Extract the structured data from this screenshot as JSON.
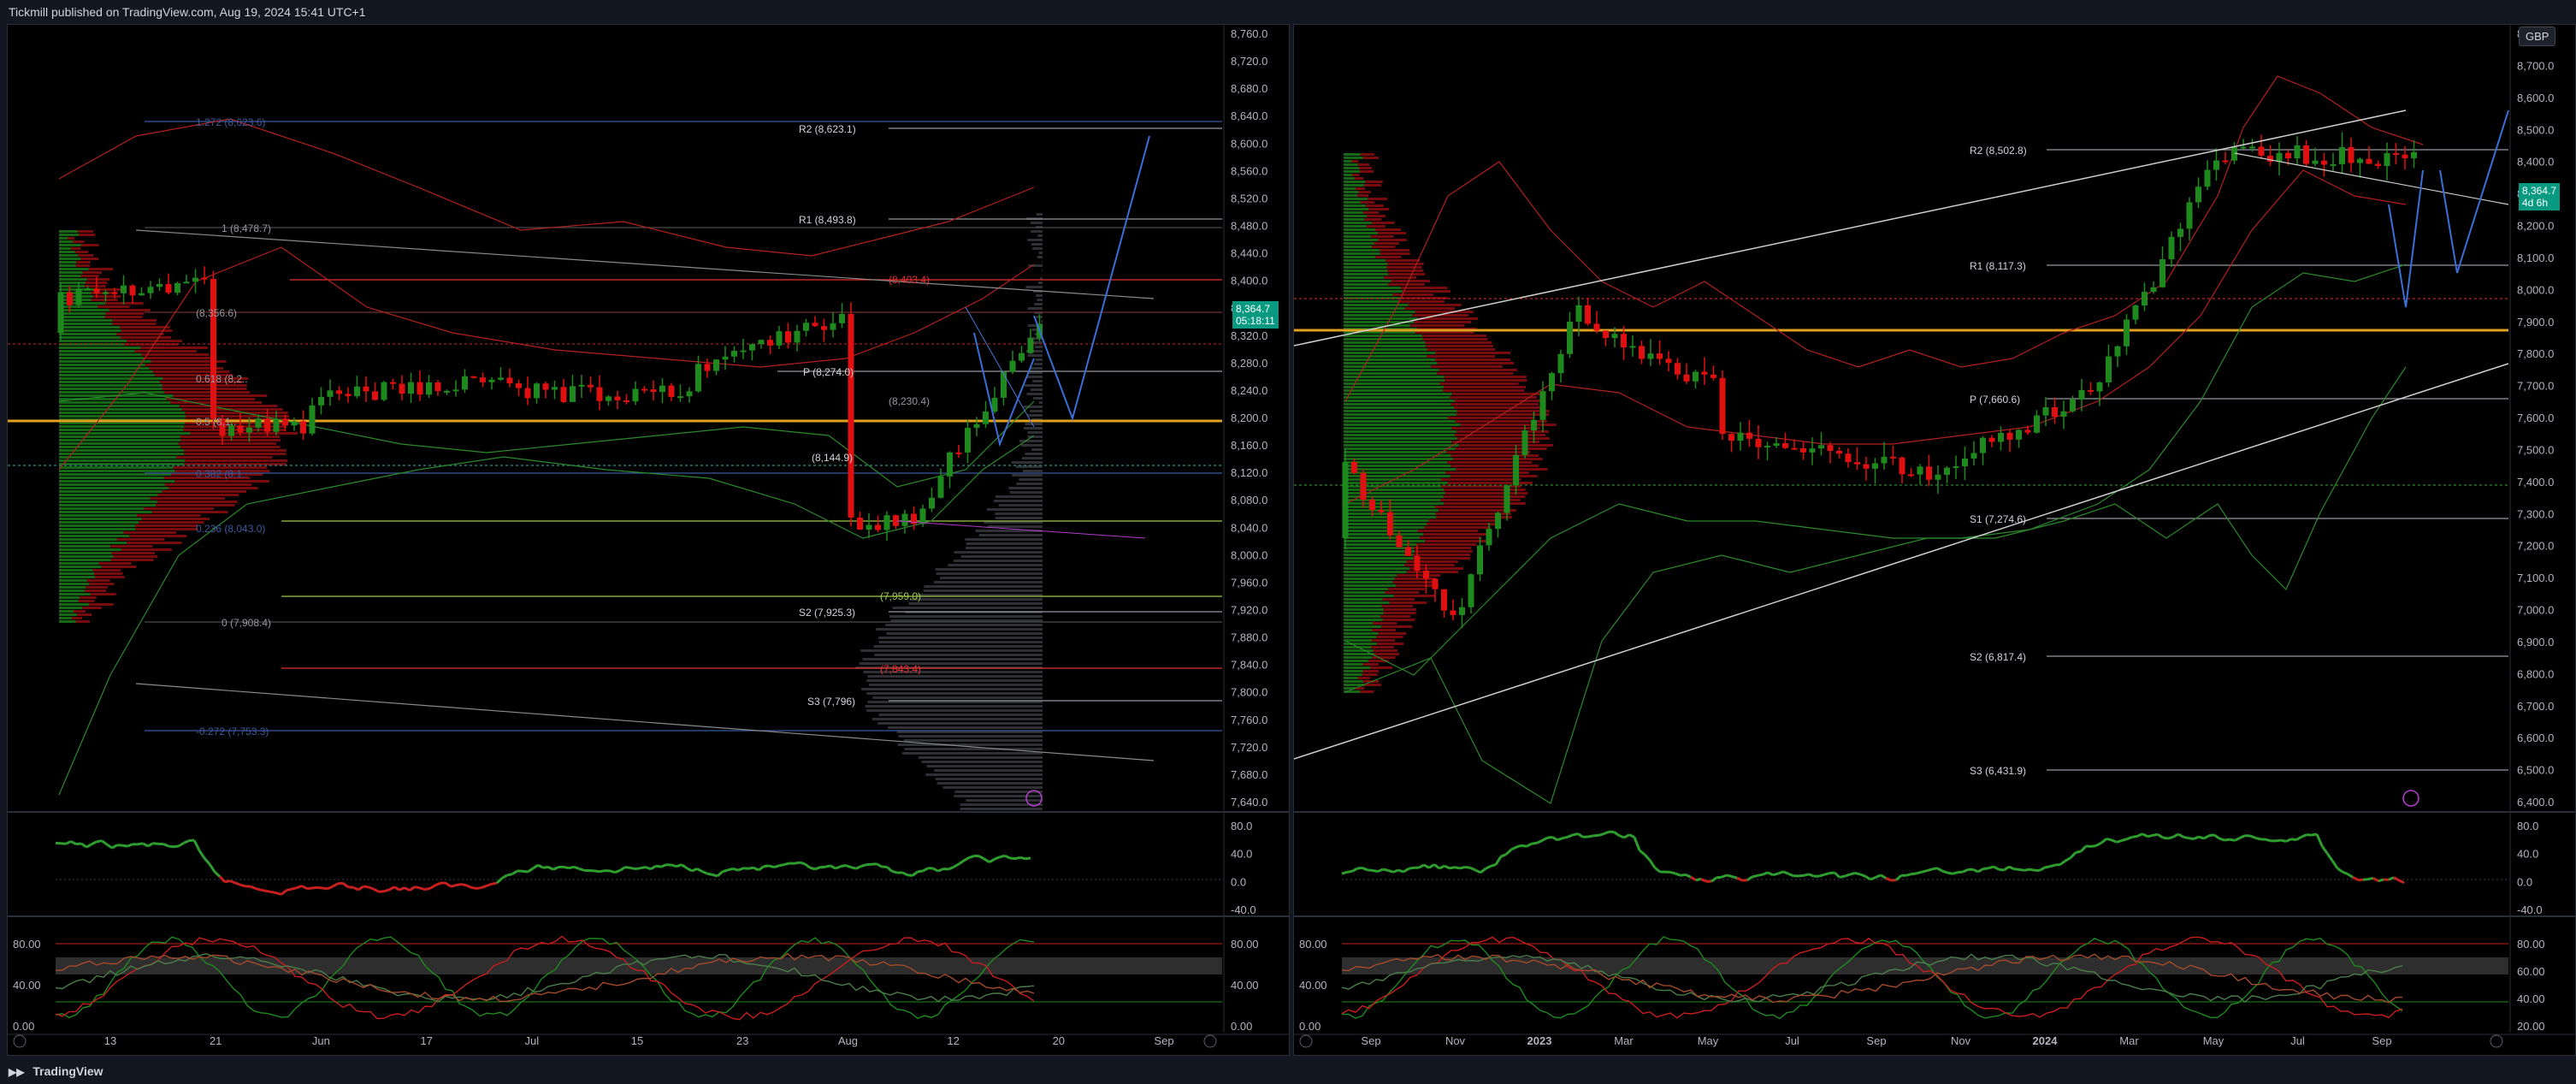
{
  "header": {
    "publisher": "Tickmill published on TradingView.com, Aug 19, 2024 15:41 UTC+1"
  },
  "footer": {
    "brand": "TradingView"
  },
  "colors": {
    "up": "#1e8a1e",
    "down": "#e01010",
    "bg": "#000000",
    "grid": "#1c1f26"
  },
  "left": {
    "price_axis": [
      "8,760.0",
      "8,720.0",
      "8,680.0",
      "8,640.0",
      "8,600.0",
      "8,560.0",
      "8,520.0",
      "8,480.0",
      "8,440.0",
      "8,400.0",
      "8,360.0",
      "8,320.0",
      "8,280.0",
      "8,240.0",
      "8,200.0",
      "8,160.0",
      "8,120.0",
      "8,080.0",
      "8,040.0",
      "8,000.0",
      "7,960.0",
      "7,920.0",
      "7,880.0",
      "7,840.0",
      "7,800.0",
      "7,760.0",
      "7,720.0",
      "7,680.0",
      "7,640.0"
    ],
    "price_badge": {
      "price": "8,364.7",
      "timer": "05:18:11"
    },
    "time_axis": [
      "13",
      "21",
      "Jun",
      "17",
      "Jul",
      "15",
      "23",
      "Aug",
      "12",
      "20",
      "Sep"
    ],
    "fib_labels": [
      "1.272 (8,623.6)",
      "1 (8,478.7)",
      "(8,356.6)",
      "0.618 (8,2..",
      "0.5 (8,1..",
      "0.382 (8,1..",
      "0.236 (8,043.0)",
      "0 (7,908.4)",
      "-0.272 (7,753.3)"
    ],
    "pivot_labels": [
      "R2 (8,623.1)",
      "R1 (8,493.8)",
      "(8,403.4)",
      "P (8,274.0)",
      "(8,230.4)",
      "(8,144.9)",
      "(7,959.0)",
      "S2 (7,925.3)",
      "(7,843.4)",
      "S3 (7,796)"
    ],
    "osc1_axis": [
      "80.0",
      "40.0",
      "0.0",
      "-40.0"
    ],
    "osc2_axis": [
      "80.00",
      "40.00",
      "0.00"
    ],
    "osc2_axis_right": [
      "80.00",
      "40.00",
      "0.00"
    ]
  },
  "right": {
    "currency": "GBP",
    "price_axis": [
      "8,800.0",
      "8,700.0",
      "8,600.0",
      "8,500.0",
      "8,400.0",
      "8,300.0",
      "8,200.0",
      "8,100.0",
      "8,000.0",
      "7,900.0",
      "7,800.0",
      "7,700.0",
      "7,600.0",
      "7,500.0",
      "7,400.0",
      "7,300.0",
      "7,200.0",
      "7,100.0",
      "7,000.0",
      "6,900.0",
      "6,800.0",
      "6,700.0",
      "6,600.0",
      "6,500.0",
      "6,400.0"
    ],
    "price_badge": {
      "price": "8,364.7",
      "timer": "4d 6h"
    },
    "time_axis": [
      "Sep",
      "Nov",
      "2023",
      "Mar",
      "May",
      "Jul",
      "Sep",
      "Nov",
      "2024",
      "Mar",
      "May",
      "Jul",
      "Sep"
    ],
    "pivot_labels": [
      "R2 (8,502.8)",
      "R1 (8,117.3)",
      "P (7,660.6)",
      "S1 (7,274.6)",
      "S2 (6,817.4)",
      "S3 (6,431.9)"
    ],
    "osc1_axis": [
      "80.0",
      "40.0",
      "0.0",
      "-40.0"
    ],
    "osc2_axis": [
      "80.00",
      "40.00",
      "0.00"
    ],
    "osc2_axis_right": [
      "80.00",
      "60.00",
      "40.00",
      "20.00"
    ]
  }
}
